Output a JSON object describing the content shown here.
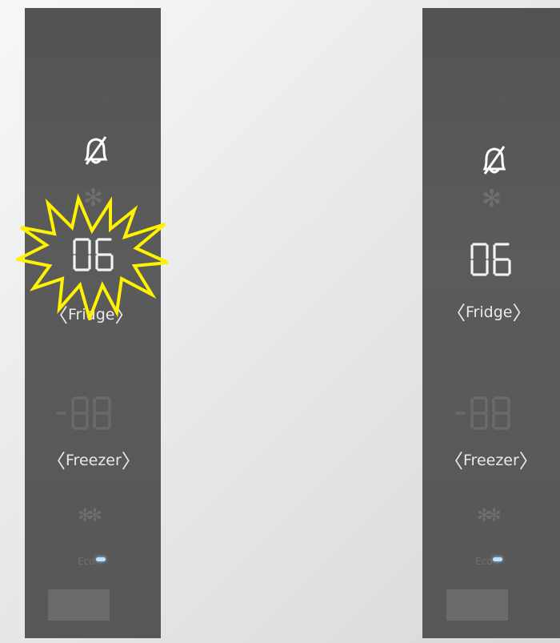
{
  "left_panel": {
    "display_value": "06",
    "fridge_label": "Fridge",
    "freezer_label": "Freezer",
    "eco_label": "Eco",
    "highlight": "starburst"
  },
  "right_panel": {
    "display_value": "06",
    "fridge_label": "Fridge",
    "freezer_label": "Freezer",
    "eco_label": "Eco"
  },
  "icons": [
    "bell-off-icon",
    "snowflake-icon",
    "super-freeze-icon",
    "chevron-left-icon",
    "chevron-right-icon"
  ],
  "colors": {
    "panel": "#575757",
    "text": "#e9e9e9",
    "burst": "#fff200",
    "dim": "#6f6f6f"
  }
}
